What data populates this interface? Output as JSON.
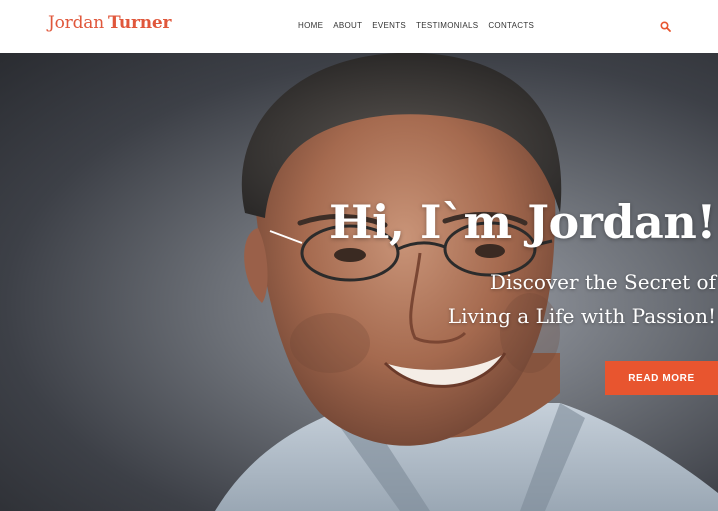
{
  "brand": {
    "first": "Jordan",
    "last": "Turner",
    "color": "#e0573b"
  },
  "nav": [
    {
      "label": "HOME"
    },
    {
      "label": "ABOUT"
    },
    {
      "label": "EVENTS"
    },
    {
      "label": "TESTIMONIALS"
    },
    {
      "label": "CONTACTS"
    }
  ],
  "search": {
    "icon": "search-icon",
    "color": "#e8552f"
  },
  "hero": {
    "title": "Hi, I`m Jordan!",
    "subtitle_line1": "Discover the Secret of",
    "subtitle_line2": "Living a Life with Passion!",
    "cta_label": "READ MORE",
    "cta_color": "#e8552f"
  }
}
